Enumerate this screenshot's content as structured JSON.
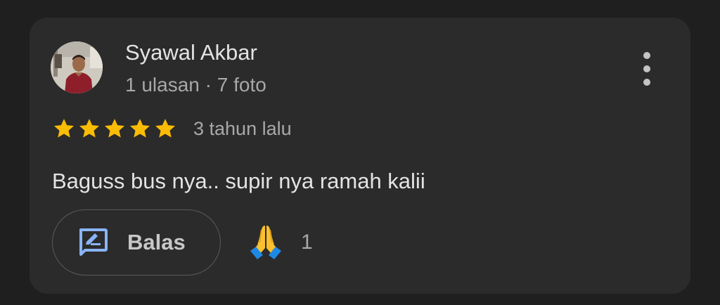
{
  "review": {
    "author": {
      "name": "Syawal Akbar",
      "stats": "1 ulasan · 7 foto",
      "avatar_icon": "person-photo-avatar"
    },
    "rating": 5,
    "max_rating": 5,
    "time_ago": "3 tahun lalu",
    "text": "Baguss bus nya.. supir nya ramah kalii",
    "more_options_icon": "vertical-dots-icon",
    "actions": {
      "reply_label": "Balas",
      "reply_icon": "reply-comment-icon",
      "reaction_icon": "folded-hands-icon",
      "reaction_count": "1"
    },
    "colors": {
      "background": "#1f1f1f",
      "card": "#2b2b2b",
      "star": "#fbbc04",
      "accent_blue": "#8ab4f8",
      "primary_text": "#e3e3e3",
      "secondary_text": "#a8a8a8"
    }
  }
}
